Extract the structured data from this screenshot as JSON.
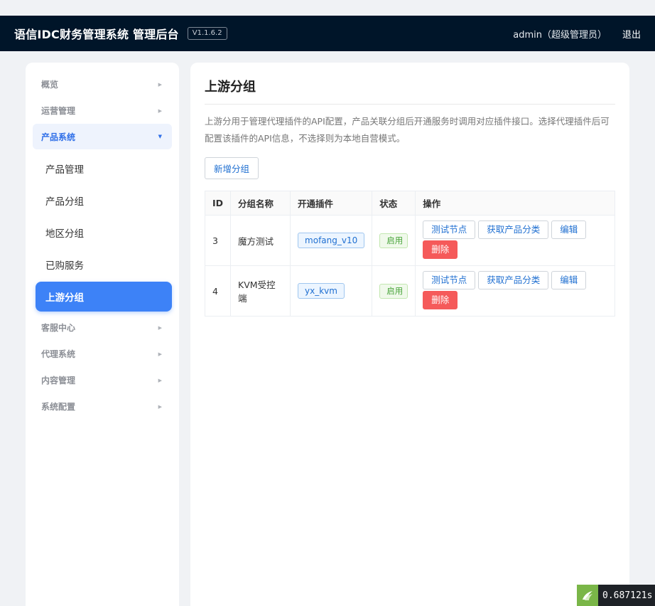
{
  "header": {
    "title": "语信IDC财务管理系统 管理后台",
    "version": "V1.1.6.2",
    "user": "admin（超级管理员）",
    "logout": "退出"
  },
  "sidebar": {
    "groups_top": [
      {
        "label": "概览"
      },
      {
        "label": "运营管理"
      }
    ],
    "open_group": {
      "label": "产品系统",
      "items": [
        {
          "label": "产品管理"
        },
        {
          "label": "产品分组"
        },
        {
          "label": "地区分组"
        },
        {
          "label": "已购服务"
        },
        {
          "label": "上游分组",
          "active": true
        }
      ]
    },
    "groups_bottom": [
      {
        "label": "客服中心"
      },
      {
        "label": "代理系统"
      },
      {
        "label": "内容管理"
      },
      {
        "label": "系统配置"
      }
    ]
  },
  "main": {
    "title": "上游分组",
    "description": "上游分用于管理代理插件的API配置，产品关联分组后开通服务时调用对应插件接口。选择代理插件后可配置该插件的API信息，不选择则为本地自营模式。",
    "add_button": "新增分组",
    "table": {
      "headers": [
        "ID",
        "分组名称",
        "开通插件",
        "状态",
        "操作"
      ],
      "rows": [
        {
          "id": "3",
          "name": "魔方测试",
          "plugin": "mofang_v10",
          "status": "启用"
        },
        {
          "id": "4",
          "name": "KVM受控端",
          "plugin": "yx_kvm",
          "status": "启用"
        }
      ],
      "actions": {
        "test": "测试节点",
        "fetch": "获取产品分类",
        "edit": "编辑",
        "delete": "删除"
      }
    }
  },
  "debug_timer": "0.687121s",
  "colors": {
    "header_bg": "#001529",
    "accent": "#3d82f7",
    "danger": "#f55a5a",
    "success": "#4aa53c"
  }
}
